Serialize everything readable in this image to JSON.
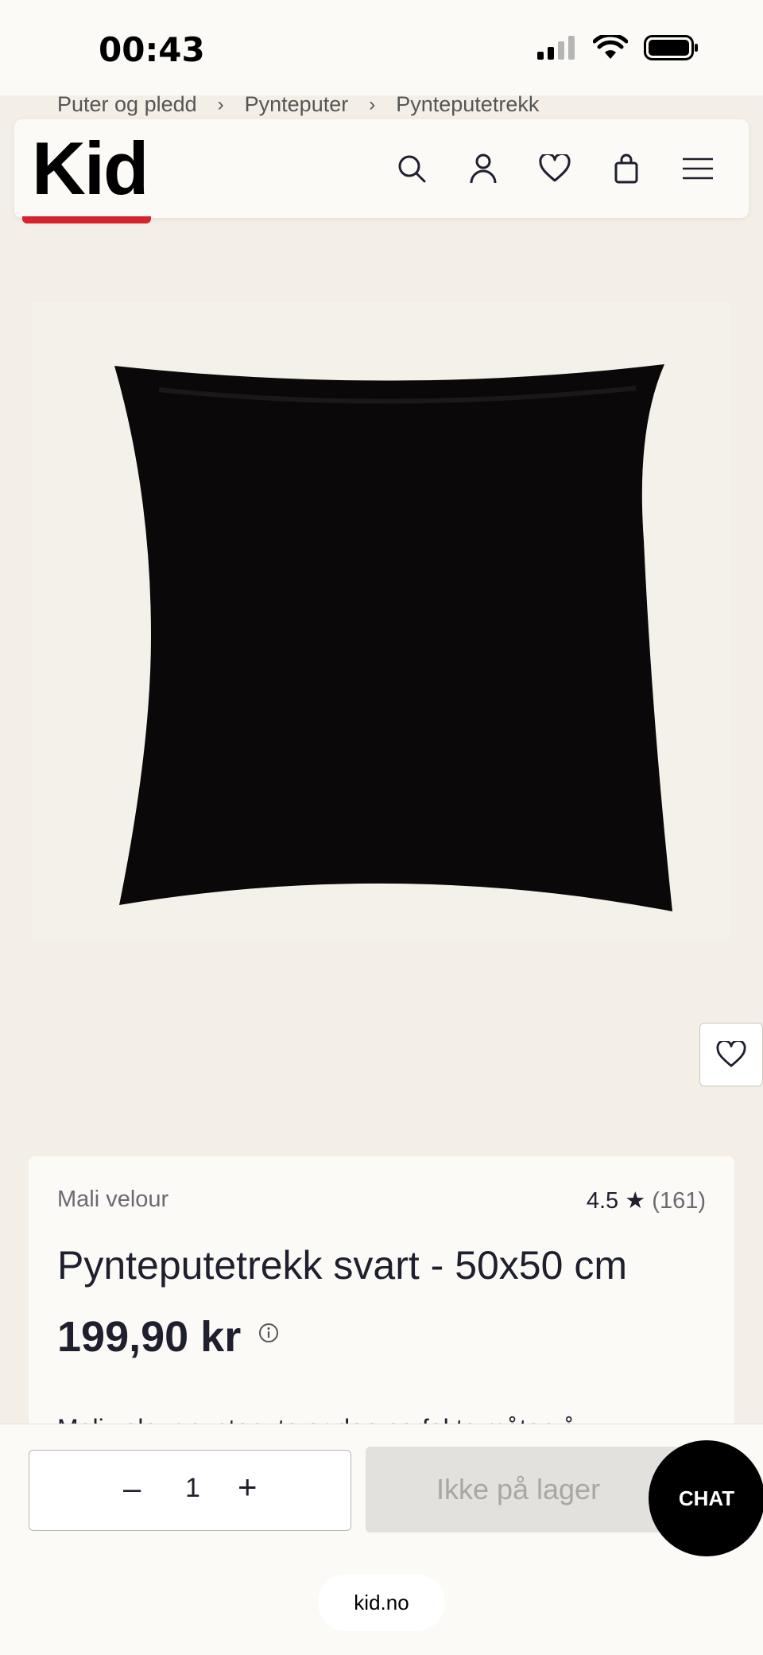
{
  "status_bar": {
    "time": "00:43",
    "icons": [
      "signal-icon",
      "wifi-icon",
      "battery-icon"
    ]
  },
  "breadcrumb": {
    "items": [
      "Puter og pledd",
      "Pynteputer",
      "Pynteputetrekk"
    ]
  },
  "header": {
    "logo": "Kid",
    "icons": [
      "search-icon",
      "account-icon",
      "wishlist-icon",
      "cart-icon",
      "menu-icon"
    ]
  },
  "product": {
    "brand": "Mali velour",
    "rating": "4.5",
    "rating_star": "★",
    "rating_count": "(161)",
    "title": "Pynteputetrekk svart - 50x50 cm",
    "price": "199,90 kr",
    "description_start": "Mali velour pyntepute er den perfekte måten å"
  },
  "bottom_bar": {
    "qty_minus": "–",
    "qty_value": "1",
    "qty_plus": "+",
    "stock_label": "Ikke på lager",
    "chat_label": "CHAT",
    "url": "kid.no"
  },
  "colors": {
    "background": "#f3efe7",
    "accent": "#d6242c",
    "text": "#1f1f2e"
  }
}
